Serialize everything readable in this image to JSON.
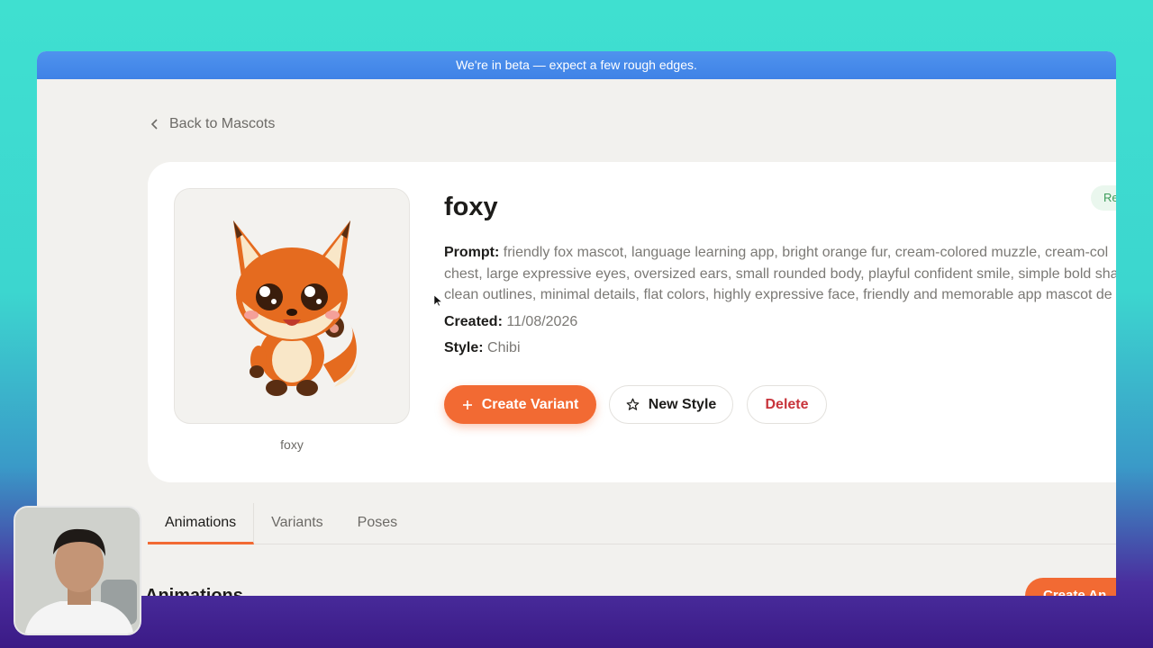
{
  "banner": {
    "text": "We're in beta — expect a few rough edges."
  },
  "nav": {
    "back_label": "Back to Mascots"
  },
  "mascot": {
    "name": "foxy",
    "caption": "foxy",
    "status": "Re",
    "prompt_label": "Prompt:",
    "prompt_lines": [
      "friendly fox mascot, language learning app, bright orange fur, cream-colored muzzle, cream-col",
      "chest, large expressive eyes, oversized ears, small rounded body, playful confident smile, simple bold sha",
      "clean outlines, minimal details, flat colors, highly expressive face, friendly and memorable app mascot de"
    ],
    "created_label": "Created:",
    "created_value": "11/08/2026",
    "style_label": "Style:",
    "style_value": "Chibi"
  },
  "actions": {
    "create_variant": "Create Variant",
    "new_style": "New Style",
    "delete": "Delete"
  },
  "tabs": [
    {
      "label": "Animations",
      "active": true
    },
    {
      "label": "Variants",
      "active": false
    },
    {
      "label": "Poses",
      "active": false
    }
  ],
  "section": {
    "heading": "Animations",
    "create_button": "Create An"
  },
  "icons": {
    "back": "chevron-left-icon",
    "plus": "plus-icon",
    "star": "star-icon"
  },
  "colors": {
    "accent": "#f26a33",
    "danger": "#c8343b",
    "banner": "#4a8cec",
    "success": "#3c9c5a"
  }
}
